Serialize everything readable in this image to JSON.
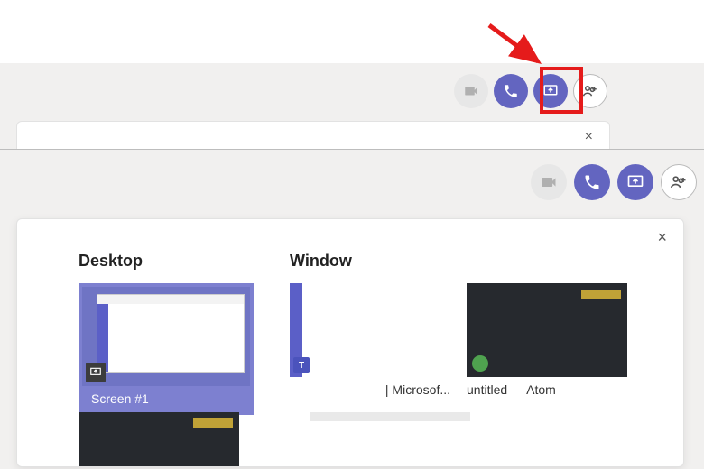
{
  "top_bar": {
    "video_label": "video-off",
    "call_label": "audio-call",
    "share_label": "share-screen",
    "add_people_label": "add-participants"
  },
  "bottom_bar": {
    "video_label": "video-off",
    "call_label": "audio-call",
    "share_label": "share-screen",
    "add_people_label": "add-participants"
  },
  "share_panel": {
    "close_label": "×",
    "sections": {
      "desktop": {
        "title": "Desktop",
        "items": [
          {
            "caption": "Screen #1"
          }
        ]
      },
      "window": {
        "title": "Window",
        "items": [
          {
            "caption": "| Microsof..."
          },
          {
            "caption": "untitled — Atom"
          }
        ],
        "row2_items": [
          {
            "caption": ""
          },
          {
            "caption": ""
          }
        ]
      }
    }
  },
  "first_popup": {
    "close_label": "×"
  },
  "colors": {
    "purple": "#6365c0",
    "highlight_red": "#e51b1b",
    "sel_purple": "#7d80d0"
  }
}
